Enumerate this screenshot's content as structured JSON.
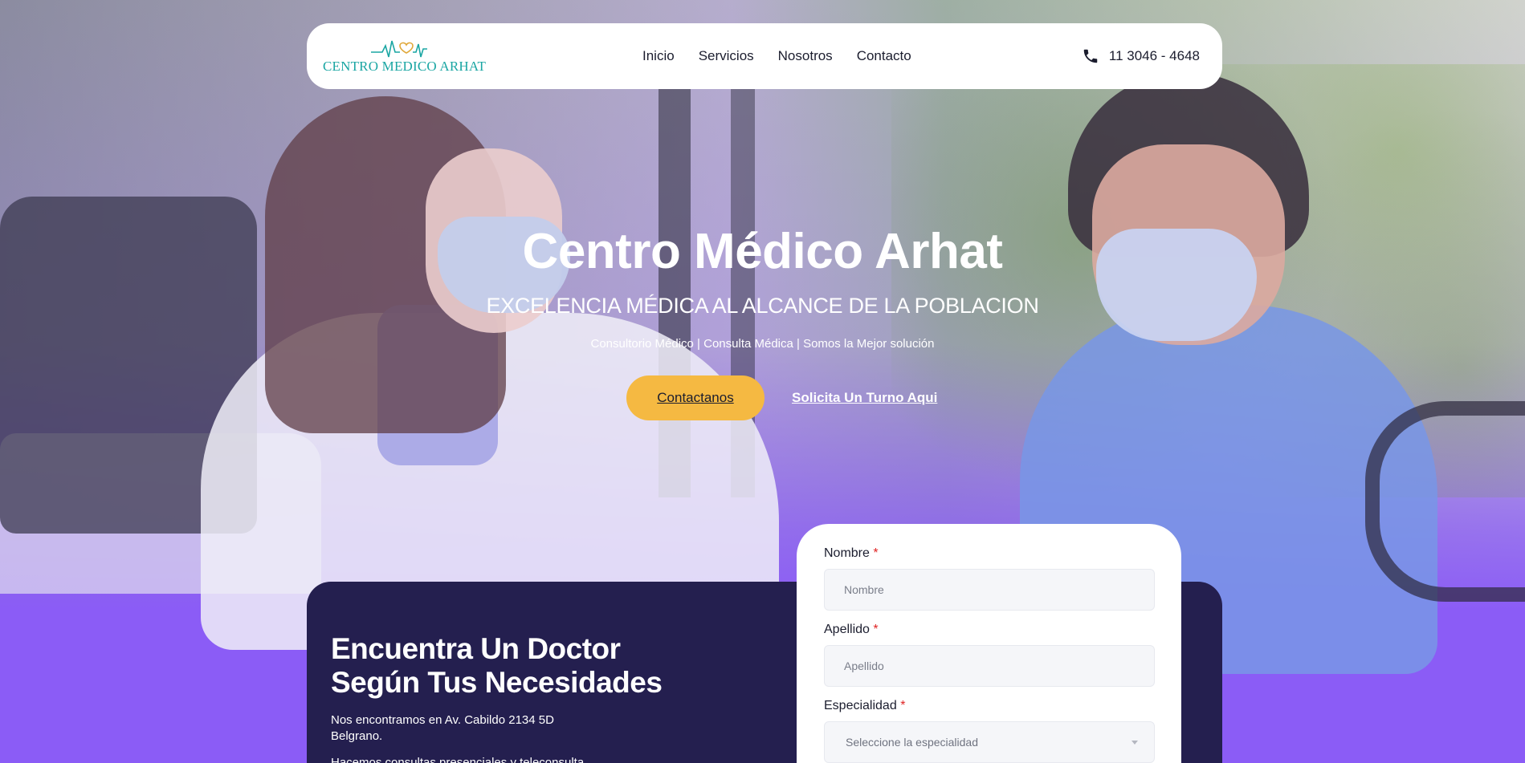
{
  "header": {
    "logo_text": "CENTRO MEDICO ARHAT",
    "nav": [
      {
        "label": "Inicio"
      },
      {
        "label": "Servicios"
      },
      {
        "label": "Nosotros"
      },
      {
        "label": "Contacto"
      }
    ],
    "phone": "11 3046 - 4648",
    "phone_icon": "phone-icon"
  },
  "hero": {
    "title": "Centro Médico Arhat",
    "subtitle": "EXCELENCIA MÉDICA AL ALCANCE DE LA POBLACION",
    "tagline": "Consultorio Médico | Consulta Médica | Somos la Mejor solución",
    "primary_button": "Contactanos",
    "secondary_link": "Solicita Un Turno Aqui"
  },
  "doctor_panel": {
    "title": "Encuentra Un Doctor Según Tus Necesidades",
    "address": "Nos encontramos en Av. Cabildo 2134 5D Belgrano.",
    "more": "Hacemos consultas presenciales y teleconsulta"
  },
  "form": {
    "fields": [
      {
        "label": "Nombre",
        "required_mark": "*",
        "placeholder": "Nombre"
      },
      {
        "label": "Apellido",
        "required_mark": "*",
        "placeholder": "Apellido"
      },
      {
        "label": "Especialidad",
        "required_mark": "*",
        "placeholder": "Seleccione la especialidad"
      }
    ]
  },
  "colors": {
    "accent_yellow": "#f5b942",
    "panel_dark": "#241f4f",
    "hero_purple": "#8b5cf6",
    "logo_teal": "#1aa6a3",
    "required_red": "#e02424"
  }
}
